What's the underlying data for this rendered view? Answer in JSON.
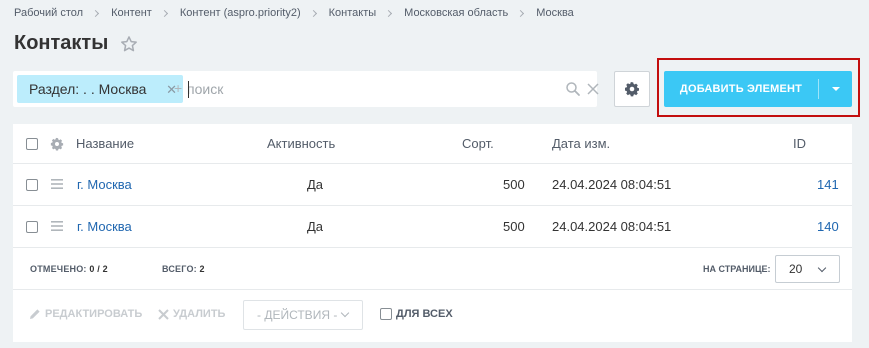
{
  "breadcrumb": [
    "Рабочий стол",
    "Контент",
    "Контент (aspro.priority2)",
    "Контакты",
    "Московская область",
    "Москва"
  ],
  "page_title": "Контакты",
  "filter": {
    "tag_label": "Раздел: . . Москва",
    "plus": "+",
    "search_placeholder": "поиск"
  },
  "toolbar": {
    "add_label": "ДОБАВИТЬ ЭЛЕМЕНТ",
    "accent_color": "#3bc8f5",
    "highlight_color": "#c30e0e"
  },
  "grid": {
    "columns": [
      "Название",
      "Активность",
      "Сорт.",
      "Дата изм.",
      "ID"
    ],
    "rows": [
      {
        "name": "г. Москва",
        "active": "Да",
        "sort": "500",
        "date": "24.04.2024 08:04:51",
        "id": "141"
      },
      {
        "name": "г. Москва",
        "active": "Да",
        "sort": "500",
        "date": "24.04.2024 08:04:51",
        "id": "140"
      }
    ]
  },
  "footer": {
    "selected_label": "ОТМЕЧЕНО:",
    "selected_value": "0 / 2",
    "total_label": "ВСЕГО:",
    "total_value": "2",
    "perpage_label": "НА СТРАНИЦЕ:",
    "perpage_value": "20"
  },
  "actions": {
    "edit_label": "РЕДАКТИРОВАТЬ",
    "delete_label": "УДАЛИТЬ",
    "select_placeholder": "- ДЕЙСТВИЯ -",
    "for_all_label": "ДЛЯ ВСЕХ"
  }
}
